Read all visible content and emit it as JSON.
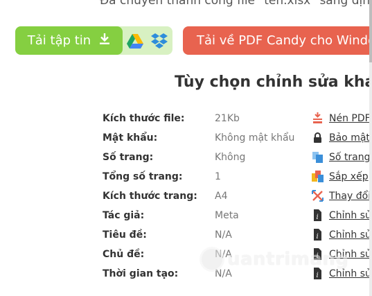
{
  "top_note": "Đã chuyển thành công file \"ten.xlsx\" sang định",
  "download_button": {
    "label": "Tải tập tin",
    "icon": "download-icon"
  },
  "cloud_icons": [
    "google-drive-icon",
    "dropbox-icon"
  ],
  "pdfcandy_button": {
    "label": "Tải về PDF Candy cho Windows"
  },
  "options_heading": "Tùy chọn chỉnh sửa khác",
  "properties": [
    {
      "label": "Kích thước file:",
      "value": "21Kb",
      "action": "Nén PDF",
      "icon": "compress-icon",
      "icon_color": "#e8634f"
    },
    {
      "label": "Mật khẩu:",
      "value": "Không mật khẩu",
      "action": "Bảo mật",
      "icon": "lock-icon",
      "icon_color": "#333333"
    },
    {
      "label": "Số trang:",
      "value": "Không",
      "action": "Số trang",
      "icon": "page-numbers-icon",
      "icon_color": "#3b8fd9"
    },
    {
      "label": "Tổng số trang:",
      "value": "1",
      "action": "Sắp xếp",
      "icon": "arrange-pages-icon",
      "icon_color": "#f2b51e"
    },
    {
      "label": "Kích thước trang:",
      "value": "A4",
      "action": "Thay đổi",
      "icon": "resize-icon",
      "icon_color": "#e8634f"
    },
    {
      "label": "Tác giả:",
      "value": "Meta",
      "action": "Chỉnh sửa",
      "icon": "edit-info-icon",
      "icon_color": "#333333"
    },
    {
      "label": "Tiêu đề:",
      "value": "N/A",
      "action": "Chỉnh sửa",
      "icon": "edit-info-icon",
      "icon_color": "#333333"
    },
    {
      "label": "Chủ đề:",
      "value": "N/A",
      "action": "Chỉnh sửa",
      "icon": "edit-info-icon",
      "icon_color": "#333333"
    },
    {
      "label": "Thời gian tạo:",
      "value": "N/A",
      "action": "Chỉnh sửa",
      "icon": "edit-info-icon",
      "icon_color": "#333333"
    }
  ],
  "watermark": "uantrimang",
  "colors": {
    "green": "#85cf41",
    "green_light": "#d8f1c2",
    "orange": "#e8634f"
  }
}
